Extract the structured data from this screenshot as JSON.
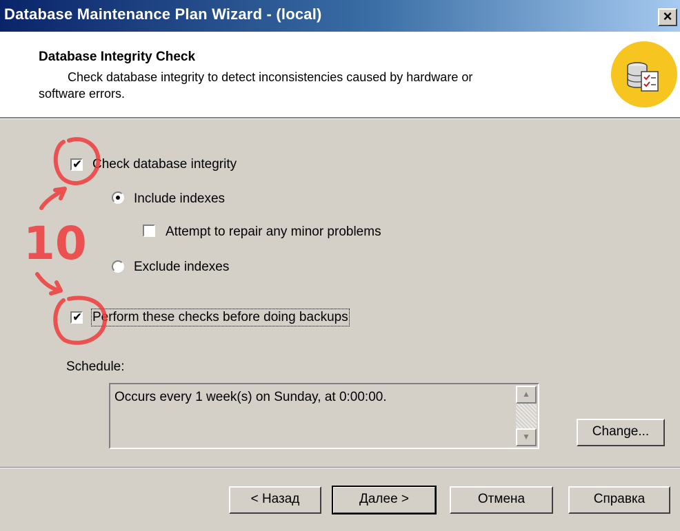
{
  "window": {
    "title": "Database Maintenance Plan Wizard - (local)",
    "close_label": "×"
  },
  "header": {
    "title": "Database Integrity Check",
    "description_line1": "Check database integrity to detect inconsistencies caused by hardware or",
    "description_line2": "software errors.",
    "icon": "database-checklist-icon"
  },
  "options": {
    "check_integrity": {
      "label": "Check database integrity",
      "checked": true
    },
    "include_indexes": {
      "label": "Include indexes",
      "selected": true
    },
    "attempt_repair": {
      "label": "Attempt to repair any minor problems",
      "checked": false
    },
    "exclude_indexes": {
      "label": "Exclude indexes",
      "selected": false
    },
    "before_backups": {
      "label": "Perform these checks before doing backups",
      "checked": true
    }
  },
  "schedule": {
    "label": "Schedule:",
    "text": "Occurs every 1 week(s) on Sunday, at 0:00:00.",
    "change_button": "Change..."
  },
  "buttons": {
    "back": "< Назад",
    "next": "Далее >",
    "cancel": "Отмена",
    "help": "Справка"
  },
  "annotation": {
    "text": "10",
    "color": "#ee3b3b"
  },
  "colors": {
    "dialog_bg": "#d4d0c8",
    "titlebar_start": "#0a246a",
    "icon_bg": "#f7c520"
  }
}
